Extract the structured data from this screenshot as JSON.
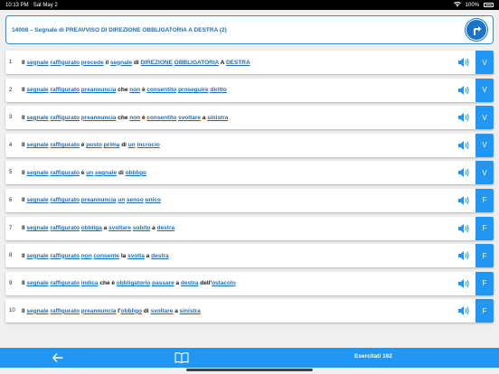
{
  "status": {
    "time": "10:13 PM",
    "date": "Sat May 2",
    "battery": "100%"
  },
  "header": {
    "title": "14008 – Segnale di PREAVVISO DI DIREZIONE OBBLIGATORIA A DESTRA (2)"
  },
  "rows": [
    {
      "num": "1",
      "answer": "V",
      "words": [
        [
          "p",
          "Il "
        ],
        [
          "w",
          "segnale"
        ],
        [
          "p",
          " "
        ],
        [
          "w",
          "raffigurato"
        ],
        [
          "p",
          " "
        ],
        [
          "w",
          "precede"
        ],
        [
          "p",
          " il "
        ],
        [
          "w",
          "segnale"
        ],
        [
          "p",
          " di "
        ],
        [
          "w",
          "DIREZIONE"
        ],
        [
          "p",
          " "
        ],
        [
          "w",
          "OBBLIGATORIA"
        ],
        [
          "p",
          " A "
        ],
        [
          "w",
          "DESTRA"
        ]
      ]
    },
    {
      "num": "2",
      "answer": "V",
      "words": [
        [
          "p",
          "Il "
        ],
        [
          "w",
          "segnale"
        ],
        [
          "p",
          " "
        ],
        [
          "w",
          "raffigurato"
        ],
        [
          "p",
          " "
        ],
        [
          "w",
          "preannuncia"
        ],
        [
          "p",
          " che "
        ],
        [
          "w",
          "non"
        ],
        [
          "p",
          " è "
        ],
        [
          "w",
          "consentito"
        ],
        [
          "p",
          " "
        ],
        [
          "w",
          "proseguire"
        ],
        [
          "p",
          " "
        ],
        [
          "w",
          "diritto"
        ]
      ]
    },
    {
      "num": "3",
      "answer": "V",
      "words": [
        [
          "p",
          "Il "
        ],
        [
          "w",
          "segnale"
        ],
        [
          "p",
          " "
        ],
        [
          "w",
          "raffigurato"
        ],
        [
          "p",
          " "
        ],
        [
          "w",
          "preannuncia"
        ],
        [
          "p",
          " che "
        ],
        [
          "w",
          "non"
        ],
        [
          "p",
          " è "
        ],
        [
          "w",
          "consentito"
        ],
        [
          "p",
          " "
        ],
        [
          "w",
          "svoltare"
        ],
        [
          "p",
          " a "
        ],
        [
          "w",
          "sinistra"
        ]
      ]
    },
    {
      "num": "4",
      "answer": "V",
      "words": [
        [
          "p",
          "Il "
        ],
        [
          "w",
          "segnale"
        ],
        [
          "p",
          " "
        ],
        [
          "w",
          "raffigurato"
        ],
        [
          "p",
          " è "
        ],
        [
          "w",
          "posto"
        ],
        [
          "p",
          " "
        ],
        [
          "w",
          "prima"
        ],
        [
          "p",
          " di "
        ],
        [
          "w",
          "un"
        ],
        [
          "p",
          " "
        ],
        [
          "w",
          "incrocio"
        ]
      ]
    },
    {
      "num": "5",
      "answer": "V",
      "words": [
        [
          "p",
          "Il "
        ],
        [
          "w",
          "segnale"
        ],
        [
          "p",
          " "
        ],
        [
          "w",
          "raffigurato"
        ],
        [
          "p",
          " è "
        ],
        [
          "w",
          "un"
        ],
        [
          "p",
          " "
        ],
        [
          "w",
          "segnale"
        ],
        [
          "p",
          " di "
        ],
        [
          "w",
          "obbligo"
        ]
      ]
    },
    {
      "num": "6",
      "answer": "F",
      "words": [
        [
          "p",
          "Il "
        ],
        [
          "w",
          "segnale"
        ],
        [
          "p",
          " "
        ],
        [
          "w",
          "raffigurato"
        ],
        [
          "p",
          " "
        ],
        [
          "w",
          "preannuncia"
        ],
        [
          "p",
          " "
        ],
        [
          "w",
          "un"
        ],
        [
          "p",
          " "
        ],
        [
          "w",
          "senso"
        ],
        [
          "p",
          " "
        ],
        [
          "w",
          "unico"
        ]
      ]
    },
    {
      "num": "7",
      "answer": "F",
      "words": [
        [
          "p",
          "Il "
        ],
        [
          "w",
          "segnale"
        ],
        [
          "p",
          " "
        ],
        [
          "w",
          "raffigurato"
        ],
        [
          "p",
          " "
        ],
        [
          "w",
          "obbliga"
        ],
        [
          "p",
          " a "
        ],
        [
          "w",
          "svoltare"
        ],
        [
          "p",
          " "
        ],
        [
          "w",
          "subito"
        ],
        [
          "p",
          " a "
        ],
        [
          "w",
          "destra"
        ]
      ]
    },
    {
      "num": "8",
      "answer": "F",
      "words": [
        [
          "p",
          "Il "
        ],
        [
          "w",
          "segnale"
        ],
        [
          "p",
          " "
        ],
        [
          "w",
          "raffigurato"
        ],
        [
          "p",
          " "
        ],
        [
          "w",
          "non"
        ],
        [
          "p",
          " "
        ],
        [
          "w",
          "consente"
        ],
        [
          "p",
          " la "
        ],
        [
          "w",
          "svolta"
        ],
        [
          "p",
          " a "
        ],
        [
          "w",
          "destra"
        ]
      ]
    },
    {
      "num": "9",
      "answer": "F",
      "words": [
        [
          "p",
          "Il "
        ],
        [
          "w",
          "segnale"
        ],
        [
          "p",
          " "
        ],
        [
          "w",
          "raffigurato"
        ],
        [
          "p",
          " "
        ],
        [
          "w",
          "indica"
        ],
        [
          "p",
          " che è "
        ],
        [
          "w",
          "obbligatorio"
        ],
        [
          "p",
          " "
        ],
        [
          "w",
          "passare"
        ],
        [
          "p",
          " a "
        ],
        [
          "w",
          "destra"
        ],
        [
          "p",
          " dell'"
        ],
        [
          "w",
          "ostacolo"
        ]
      ]
    },
    {
      "num": "10",
      "answer": "F",
      "words": [
        [
          "p",
          "Il "
        ],
        [
          "w",
          "segnale"
        ],
        [
          "p",
          " "
        ],
        [
          "w",
          "raffigurato"
        ],
        [
          "p",
          " "
        ],
        [
          "w",
          "preannuncia"
        ],
        [
          "p",
          " l'"
        ],
        [
          "w",
          "obbligo"
        ],
        [
          "p",
          " di "
        ],
        [
          "w",
          "svoltare"
        ],
        [
          "p",
          " a "
        ],
        [
          "w",
          "sinistra"
        ]
      ]
    }
  ],
  "footer": {
    "counter": "Esercitati 192"
  },
  "colors": {
    "accent": "#2196f3",
    "link": "#1d6fb8",
    "sign": "#1a73c9"
  },
  "icons": {
    "back": "arrow-left-icon",
    "book": "open-book-icon",
    "speaker": "speaker-icon",
    "sign": "turn-right-sign-icon"
  }
}
